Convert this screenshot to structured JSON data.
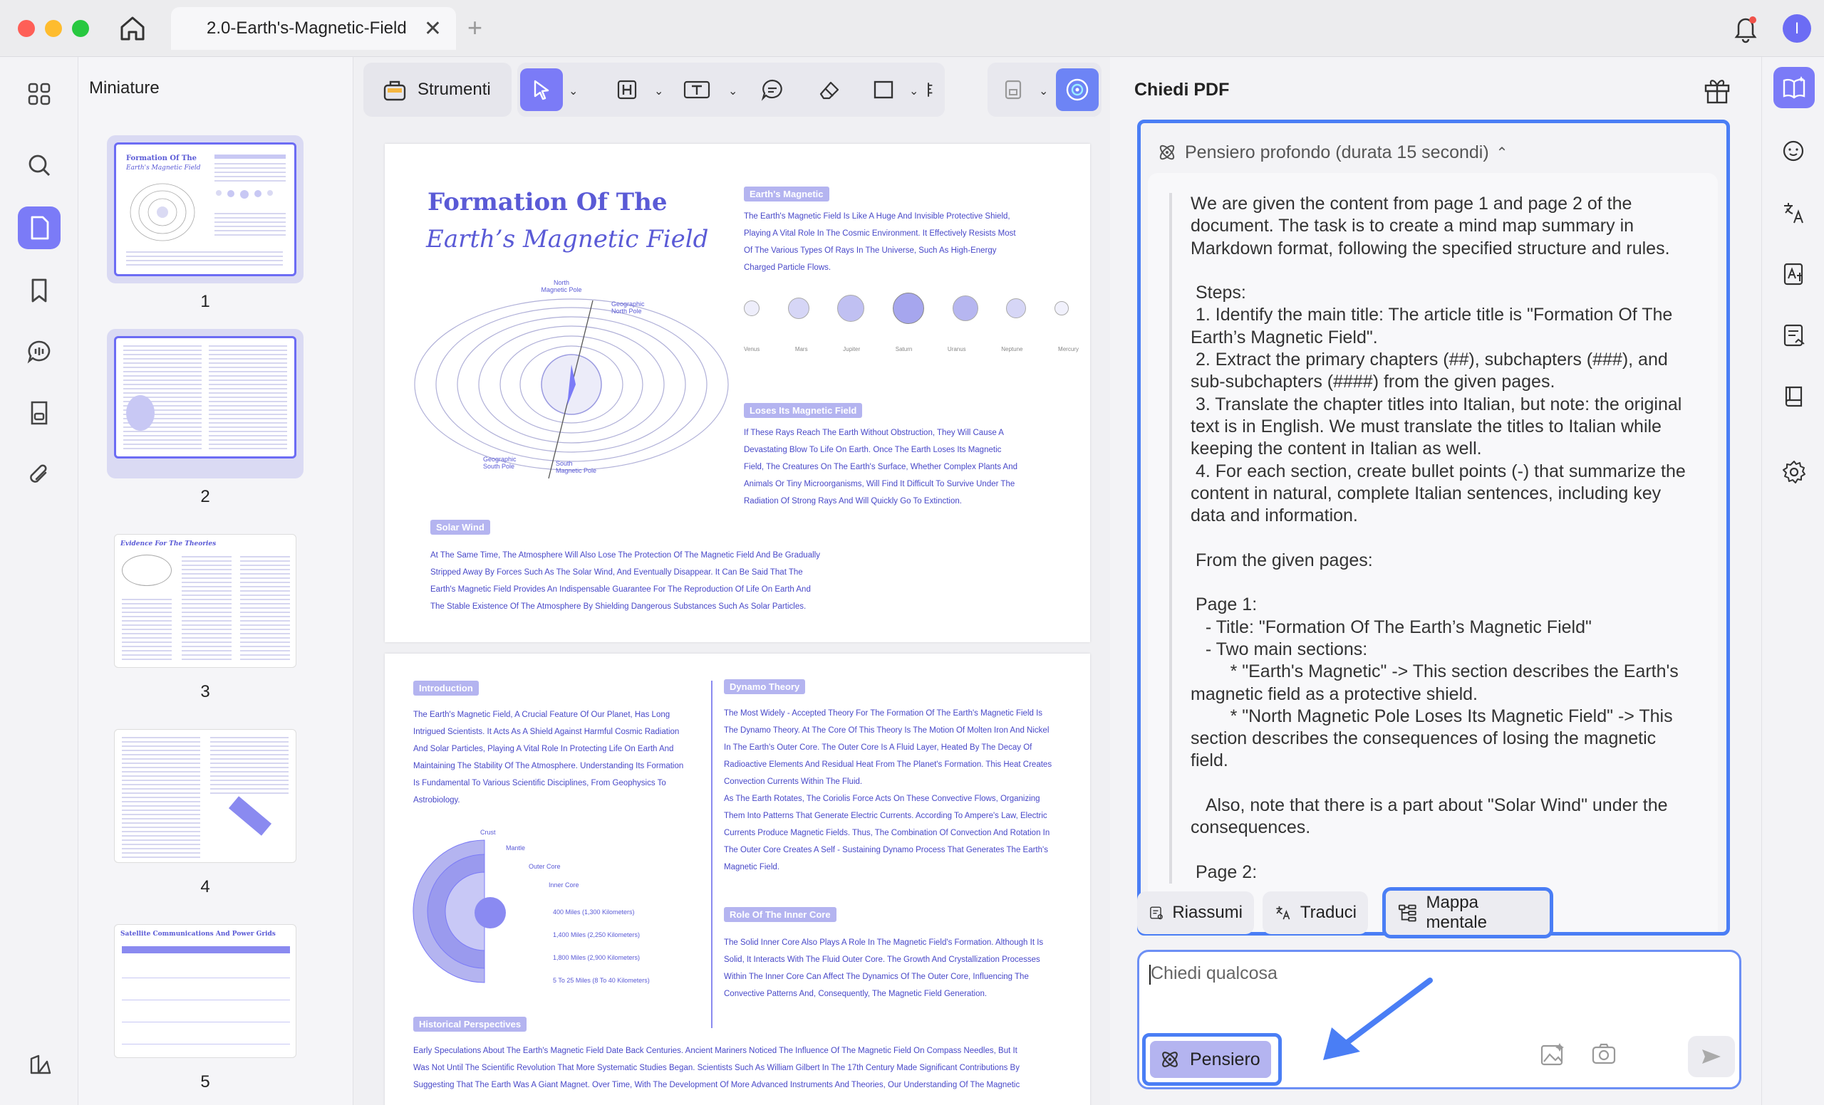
{
  "tab": {
    "title": "2.0-Earth's-Magnetic-Field",
    "close": "✕",
    "add": "+"
  },
  "user": {
    "initial": "I"
  },
  "left_panel": {
    "title": "Miniature"
  },
  "thumbnails": [
    {
      "num": "1",
      "title": "Formation Of The",
      "subtitle": "Earth's Magnetic Field"
    },
    {
      "num": "2"
    },
    {
      "num": "3",
      "title": "Evidence For The Theories"
    },
    {
      "num": "4"
    },
    {
      "num": "5",
      "title": "Satellite Communications And Power Grids"
    }
  ],
  "toolbar": {
    "tools_label": "Strumenti"
  },
  "page1": {
    "title_line1": "Formation Of The",
    "title_line2": "Earth’s Magnetic Field",
    "tag_magnetic": "Earth's Magnetic",
    "magnetic_text": [
      "The Earth's Magnetic Field Is Like A Huge And Invisible Protective Shield,",
      "Playing A Vital Role In The Cosmic Environment. It Effectively Resists Most",
      "Of The Various Types Of Rays In The Universe, Such As High-Energy",
      "Charged Particle Flows."
    ],
    "planets": [
      "Venus",
      "Mars",
      "Jupiter",
      "Saturn",
      "Uranus",
      "Neptune",
      "Mercury"
    ],
    "tag_loses": "Loses Its Magnetic Field",
    "loses_text": [
      "If These Rays Reach The Earth Without Obstruction, They Will Cause A",
      "Devastating Blow To Life On Earth. Once The Earth Loses Its Magnetic",
      "Field, The Creatures On The Earth's Surface, Whether Complex Plants And",
      "Animals Or Tiny Microorganisms, Will Find It Difficult To Survive Under The",
      "Radiation Of Strong Rays And Will Quickly Go To Extinction."
    ],
    "pole_labels": [
      "North Magnetic Pole",
      "Geographic North Pole",
      "Geographic South Pole",
      "South Magnetic Pole"
    ],
    "tag_solar": "Solar Wind",
    "solar_text": [
      "At The Same Time, The Atmosphere Will Also Lose The Protection Of The Magnetic Field And Be Gradually",
      "Stripped Away By Forces Such As The Solar Wind, And Eventually Disappear. It Can Be Said That The",
      "Earth's Magnetic Field Provides An Indispensable Guarantee For The Reproduction Of Life On Earth And",
      "The Stable Existence Of The Atmosphere By Shielding Dangerous Substances Such As Solar Particles."
    ]
  },
  "page2": {
    "tag_intro": "Introduction",
    "intro_text": [
      "The Earth's Magnetic Field, A Crucial Feature Of Our Planet, Has Long",
      "Intrigued Scientists. It Acts As A Shield Against Harmful Cosmic Radiation",
      "And Solar Particles, Playing A Vital Role In Protecting Life On Earth And",
      "Maintaining The Stability Of The Atmosphere. Understanding Its Formation",
      "Is Fundamental To Various Scientific Disciplines, From Geophysics To",
      "Astrobiology."
    ],
    "layer_labels": [
      "Crust",
      "Mantle",
      "Outer Core",
      "Inner Core"
    ],
    "depth_labels": [
      "400 Miles (1,300 Kilometers)",
      "1,400 Miles (2,250 Kilometers)",
      "1,800 Miles (2,900 Kilometers)",
      "5 To 25 Miles (8 To 40 Kilometers)"
    ],
    "tag_dynamo": "Dynamo Theory",
    "dynamo_text": [
      "The Most Widely - Accepted Theory For The Formation Of The Earth's Magnetic Field Is",
      "The Dynamo Theory. At The Core Of This Theory Is The Motion Of Molten Iron And Nickel",
      "In The Earth's Outer Core. The Outer Core Is A Fluid Layer, Heated By The Decay Of",
      "Radioactive Elements And Residual Heat From The Planet's Formation. This Heat Creates",
      "Convection Currents Within The Fluid.",
      "As The Earth Rotates, The Coriolis Force Acts On These Convective Flows, Organizing",
      "Them Into Patterns That Generate Electric Currents. According To Ampere's Law, Electric",
      "Currents Produce Magnetic Fields. Thus, The Combination Of Convection And Rotation In",
      "The Outer Core Creates A Self - Sustaining Dynamo Process That Generates The Earth's",
      "Magnetic Field."
    ],
    "tag_inner": "Role Of The Inner Core",
    "inner_text": [
      "The Solid Inner Core Also Plays A Role In The Magnetic Field's Formation. Although It Is",
      "Solid, It Interacts With The Fluid Outer Core. The Growth And Crystallization Processes",
      "Within The Inner Core Can Affect The Dynamics Of The Outer Core, Influencing The",
      "Convective Patterns And, Consequently, The Magnetic Field Generation."
    ],
    "tag_hist": "Historical Perspectives",
    "hist_text": [
      "Early Speculations About The Earth's Magnetic Field Date Back Centuries. Ancient Mariners Noticed The Influence Of The Magnetic Field On Compass Needles, But It",
      "Was Not Until The Scientific Revolution That More Systematic Studies Began. Scientists Such As William Gilbert In The 17th Century Made Significant Contributions By",
      "Suggesting That The Earth Was A Giant Magnet. Over Time, With The Development Of More Advanced Instruments And Theories, Our Understanding Of The Magnetic"
    ]
  },
  "chat": {
    "title": "Chiedi PDF",
    "thinking_header": "Pensiero profondo (durata 15 secondi)",
    "thinking_text": "We are given the content from page 1 and page 2 of the document. The task is to create a mind map summary in Markdown format, following the specified structure and rules.\n\n Steps:\n 1. Identify the main title: The article title is \"Formation Of The Earth’s Magnetic Field\".\n 2. Extract the primary chapters (##), subchapters (###), and sub-subchapters (####) from the given pages.\n 3. Translate the chapter titles into Italian, but note: the original text is in English. We must translate the titles to Italian while keeping the content in Italian as well.\n 4. For each section, create bullet points (-) that summarize the content in natural, complete Italian sentences, including key data and information.\n\n From the given pages:\n\n Page 1:\n   - Title: \"Formation Of The Earth’s Magnetic Field\"\n   - Two main sections:\n        * \"Earth's Magnetic\" -> This section describes the Earth's magnetic field as a protective shield.\n        * \"North Magnetic Pole Loses Its Magnetic Field\" -> This section describes the consequences of losing the magnetic field.\n\n   Also, note that there is a part about \"Solar Wind\" under the consequences.\n\n Page 2:",
    "quick_actions": {
      "summarize": "Riassumi",
      "translate": "Traduci",
      "mindmap": "Mappa mentale"
    },
    "input_placeholder": "Chiedi qualcosa",
    "think_button": "Pensiero"
  },
  "colors": {
    "accent": "#7b7bf7",
    "highlight": "#4a7ef5",
    "doc_ink": "#5a5ad6"
  }
}
